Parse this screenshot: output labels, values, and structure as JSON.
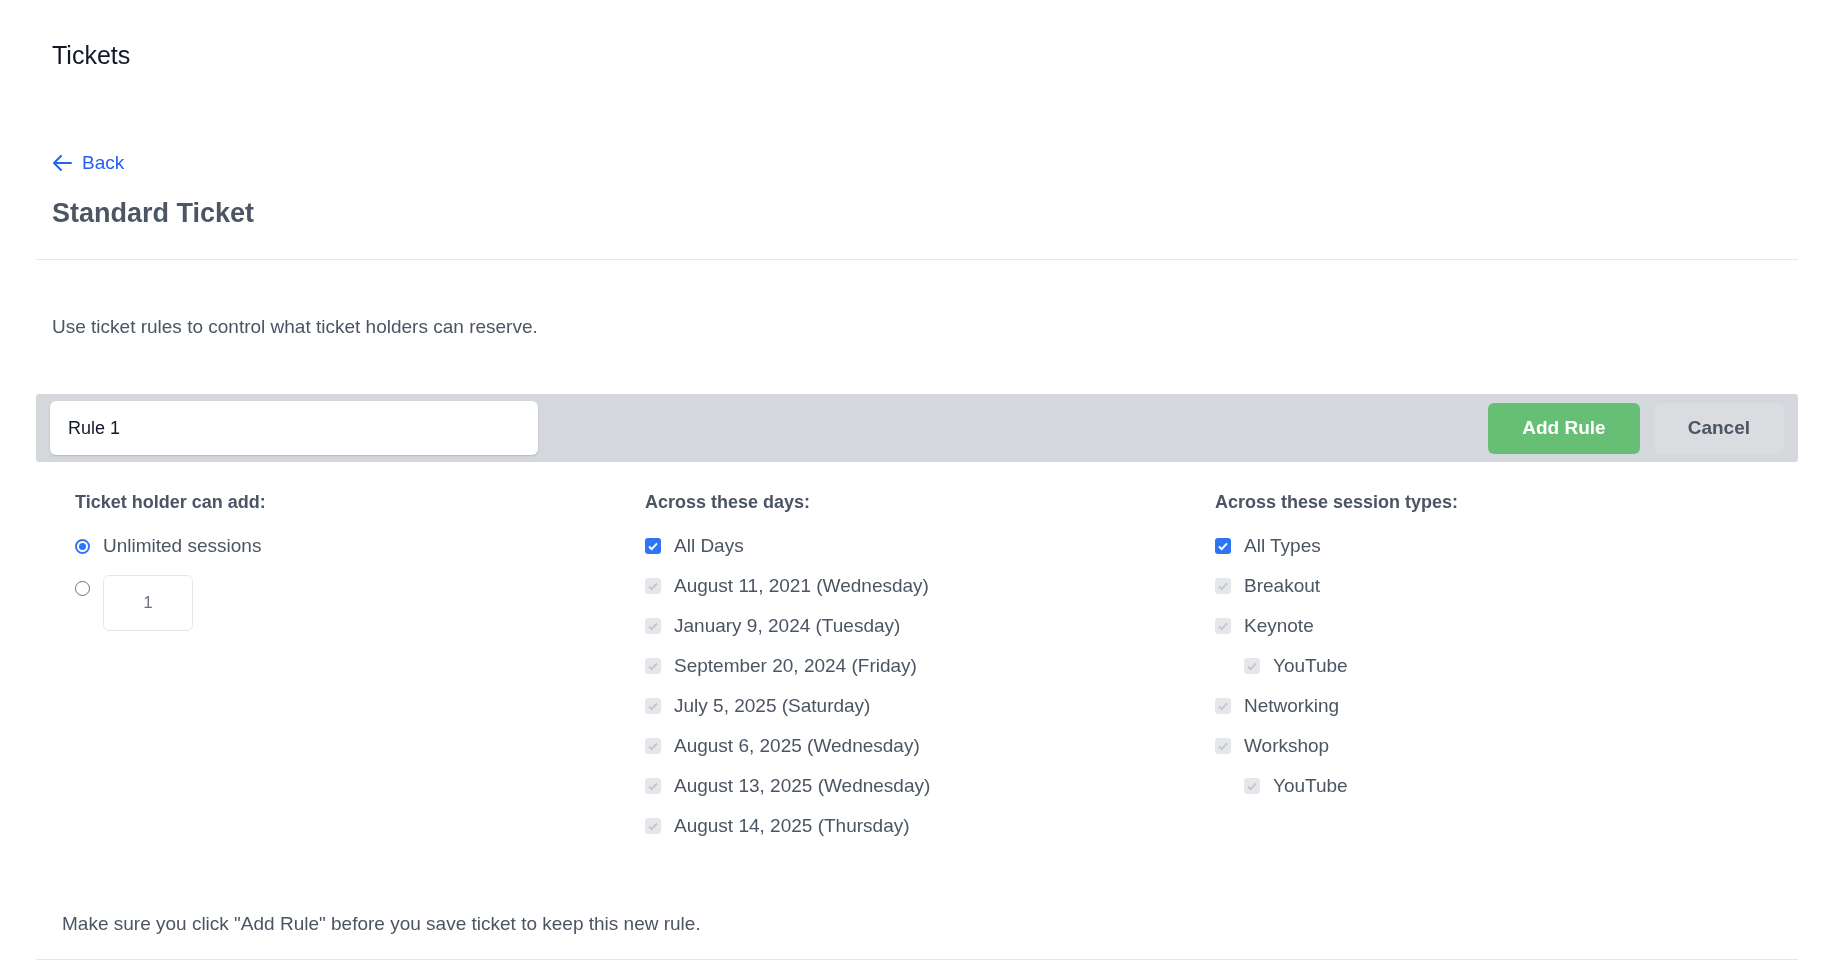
{
  "page_title": "Tickets",
  "back_link": "Back",
  "ticket_title": "Standard Ticket",
  "description": "Use ticket rules to control what ticket holders can reserve.",
  "rule": {
    "name_value": "Rule 1",
    "buttons": [
      {
        "label": "Add Rule",
        "kind": "primary"
      },
      {
        "label": "Cancel",
        "kind": "secondary"
      }
    ]
  },
  "limit": {
    "heading": "Ticket holder can add:",
    "options": [
      {
        "kind": "label",
        "label": "Unlimited sessions",
        "selected": true
      },
      {
        "kind": "number",
        "value": "1",
        "selected": false
      }
    ]
  },
  "days": {
    "heading": "Across these days:",
    "items": [
      {
        "label": "All Days",
        "checked": true,
        "disabled": false
      },
      {
        "label": "August 11, 2021 (Wednesday)",
        "checked": true,
        "disabled": true
      },
      {
        "label": "January 9, 2024 (Tuesday)",
        "checked": true,
        "disabled": true
      },
      {
        "label": "September 20, 2024 (Friday)",
        "checked": true,
        "disabled": true
      },
      {
        "label": "July 5, 2025 (Saturday)",
        "checked": true,
        "disabled": true
      },
      {
        "label": "August 6, 2025 (Wednesday)",
        "checked": true,
        "disabled": true
      },
      {
        "label": "August 13, 2025 (Wednesday)",
        "checked": true,
        "disabled": true
      },
      {
        "label": "August 14, 2025 (Thursday)",
        "checked": true,
        "disabled": true
      }
    ]
  },
  "session_types": {
    "heading": "Across these session types:",
    "items": [
      {
        "label": "All Types",
        "checked": true,
        "disabled": false
      },
      {
        "label": "Breakout",
        "checked": true,
        "disabled": true
      },
      {
        "label": "Keynote",
        "checked": true,
        "disabled": true,
        "children": [
          {
            "label": "YouTube",
            "checked": true,
            "disabled": true
          }
        ]
      },
      {
        "label": "Networking",
        "checked": true,
        "disabled": true
      },
      {
        "label": "Workshop",
        "checked": true,
        "disabled": true,
        "children": [
          {
            "label": "YouTube",
            "checked": true,
            "disabled": true
          }
        ]
      }
    ]
  },
  "footer_note": "Make sure you click \"Add Rule\" before you save ticket to keep this new rule."
}
